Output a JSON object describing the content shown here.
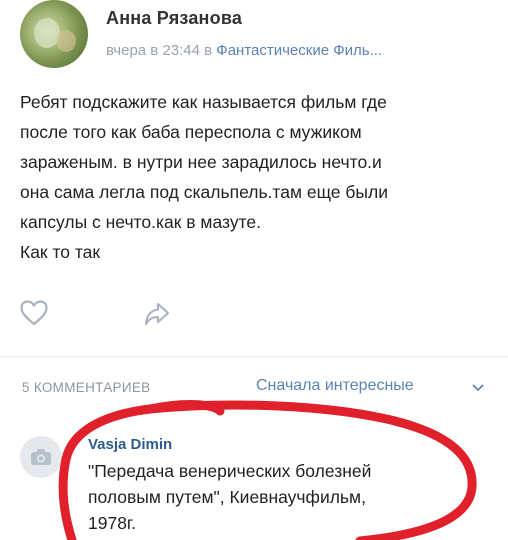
{
  "post": {
    "author": "Анна Рязанова",
    "time": "вчера в 23:44",
    "in_word": "в",
    "group": "Фантастические Филь...",
    "text_lines": [
      "Ребят подскажите как называется фильм где",
      "после того как баба переспола с мужиком",
      "зараженым. в нутри нее зарадилось нечто.и",
      "она  сама легла под скальпель.там еще были",
      "капсулы с нечто.как в мазуте.",
      "Как то так"
    ],
    "icons": {
      "like": "heart-icon",
      "share": "share-arrow-icon"
    }
  },
  "comments_section": {
    "count_label": "5 КОММЕНТАРИЕВ",
    "sort_label": "Сначала интересные",
    "sort_icon": "chevron-down-icon"
  },
  "comment": {
    "author": "Vasja Dimin",
    "text_lines": [
      "\"Передача венерических болезней",
      "половым путем\", Киевнаучфильм,",
      "1978г."
    ],
    "avatar_icon": "camera-icon"
  },
  "colors": {
    "link": "#5b82b4",
    "muted": "#9aa3ad",
    "annotation": "#e0202a"
  }
}
